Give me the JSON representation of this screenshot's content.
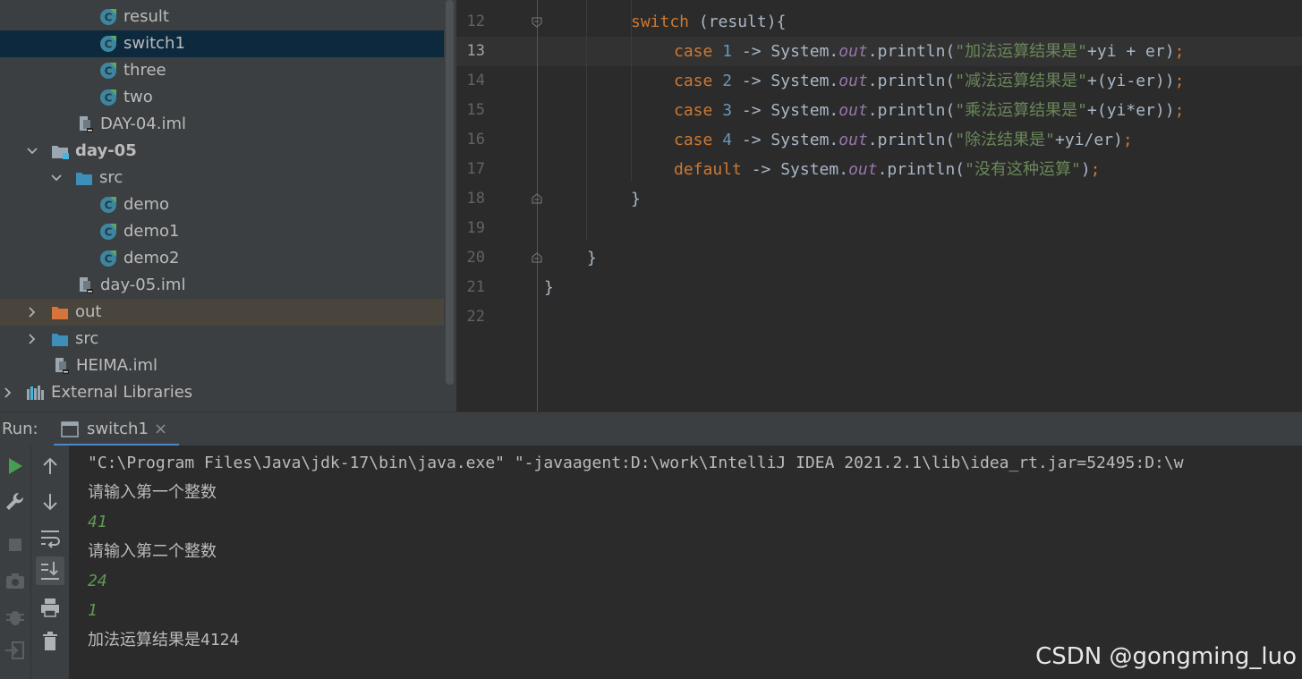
{
  "project_tree": {
    "items": [
      {
        "label": "result"
      },
      {
        "label": "switch1"
      },
      {
        "label": "three"
      },
      {
        "label": "two"
      },
      {
        "label": "DAY-04.iml"
      },
      {
        "label": "day-05"
      },
      {
        "label": "src"
      },
      {
        "label": "demo"
      },
      {
        "label": "demo1"
      },
      {
        "label": "demo2"
      },
      {
        "label": "day-05.iml"
      },
      {
        "label": "out"
      },
      {
        "label": "src"
      },
      {
        "label": "HEIMA.iml"
      },
      {
        "label": "External Libraries"
      }
    ]
  },
  "editor": {
    "line_numbers": [
      "12",
      "13",
      "14",
      "15",
      "16",
      "17",
      "18",
      "19",
      "20",
      "21",
      "22"
    ],
    "current_line": "13",
    "code": {
      "l11_tail": ";",
      "l12_kw": "switch",
      "l12_rest": " (result){",
      "l13_kw": "case",
      "l13_num": "1",
      "l13_a": " -> System.",
      "l13_out": "out",
      "l13_b": ".println(",
      "l13_str": "\"加法运算结果是\"",
      "l13_c": "+yi + er)",
      "l13_semi": ";",
      "l14_kw": "case",
      "l14_num": "2",
      "l14_a": " -> System.",
      "l14_out": "out",
      "l14_b": ".println(",
      "l14_str": "\"减法运算结果是\"",
      "l14_c": "+(yi-er))",
      "l14_semi": ";",
      "l15_kw": "case",
      "l15_num": "3",
      "l15_a": " -> System.",
      "l15_out": "out",
      "l15_b": ".println(",
      "l15_str": "\"乘法运算结果是\"",
      "l15_c": "+(yi*er))",
      "l15_semi": ";",
      "l16_kw": "case",
      "l16_num": "4",
      "l16_a": " -> System.",
      "l16_out": "out",
      "l16_b": ".println(",
      "l16_str": "\"除法结果是\"",
      "l16_c": "+yi/er)",
      "l16_semi": ";",
      "l17_kw": "default",
      "l17_a": " -> System.",
      "l17_out": "out",
      "l17_b": ".println(",
      "l17_str": "\"没有这种运算\"",
      "l17_c": ")",
      "l17_semi": ";",
      "l18": "}",
      "l20": "}",
      "l21": "}"
    }
  },
  "run_panel": {
    "label": "Run:",
    "tab_label": "switch1",
    "close_glyph": "×",
    "console_lines": [
      "\"C:\\Program Files\\Java\\jdk-17\\bin\\java.exe\" \"-javaagent:D:\\work\\IntelliJ IDEA 2021.2.1\\lib\\idea_rt.jar=52495:D:\\w",
      "请输入第一个整数",
      "41",
      "请输入第二个整数",
      "24",
      "1",
      "加法运算结果是4124"
    ]
  },
  "watermark": "CSDN @gongming_luo",
  "colors": {
    "keyword": "#cc7832",
    "number": "#6897bb",
    "string": "#6a8759",
    "static_field": "#9876aa",
    "user_input": "#629755",
    "selection": "#0d293e"
  },
  "icons": {
    "class": "java-class-icon",
    "module_file": "iml-file-icon",
    "folder": "folder-icon",
    "libraries": "libraries-icon",
    "run": "run-icon",
    "settings": "wrench-icon",
    "stop": "stop-icon",
    "camera": "camera-icon",
    "debug": "bug-icon",
    "exit": "exit-icon",
    "up": "arrow-up-icon",
    "down": "arrow-down-icon",
    "wrap": "soft-wrap-icon",
    "scroll_end": "scroll-to-end-icon",
    "print": "print-icon",
    "trash": "trash-icon",
    "console": "console-icon"
  }
}
